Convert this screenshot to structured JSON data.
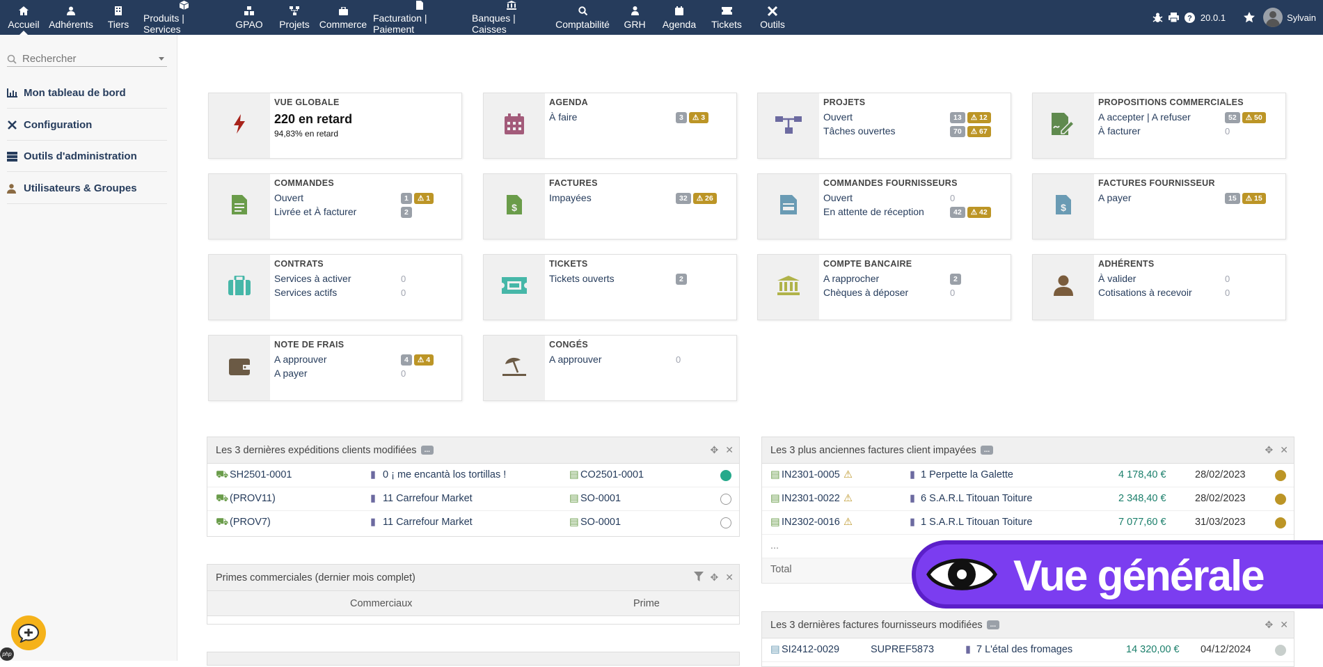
{
  "nav": {
    "items": [
      {
        "label": "Accueil",
        "icon": "home-icon"
      },
      {
        "label": "Adhérents",
        "icon": "user-icon"
      },
      {
        "label": "Tiers",
        "icon": "building-icon"
      },
      {
        "label": "Produits | Services",
        "icon": "cube-icon"
      },
      {
        "label": "GPAO",
        "icon": "cubes-icon"
      },
      {
        "label": "Projets",
        "icon": "sitemap-icon"
      },
      {
        "label": "Commerce",
        "icon": "briefcase-icon"
      },
      {
        "label": "Facturation | Paiement",
        "icon": "invoice-icon"
      },
      {
        "label": "Banques | Caisses",
        "icon": "bank-icon"
      },
      {
        "label": "Comptabilité",
        "icon": "search-dollar-icon"
      },
      {
        "label": "GRH",
        "icon": "person-icon"
      },
      {
        "label": "Agenda",
        "icon": "calendar-icon"
      },
      {
        "label": "Tickets",
        "icon": "ticket-icon"
      },
      {
        "label": "Outils",
        "icon": "tools-icon"
      }
    ],
    "version": "20.0.1",
    "user": "Sylvain"
  },
  "sidebar": {
    "search_placeholder": "Rechercher",
    "items": [
      {
        "label": "Mon tableau de bord"
      },
      {
        "label": "Configuration"
      },
      {
        "label": "Outils d'administration"
      },
      {
        "label": "Utilisateurs & Groupes"
      }
    ]
  },
  "boxes": {
    "vue_globale": {
      "title": "VUE GLOBALE",
      "main": "220 en retard",
      "sub": "94,83% en retard"
    },
    "agenda": {
      "title": "AGENDA",
      "l1": "À faire",
      "c1": "3",
      "w1": "3"
    },
    "projets": {
      "title": "PROJETS",
      "l1": "Ouvert",
      "c1": "13",
      "w1": "12",
      "l2": "Tâches ouvertes",
      "c2": "70",
      "w2": "67"
    },
    "propositions": {
      "title": "PROPOSITIONS COMMERCIALES",
      "l1": "A accepter | A refuser",
      "c1": "52",
      "w1": "50",
      "l2": "À facturer",
      "z2": "0"
    },
    "commandes": {
      "title": "COMMANDES",
      "l1": "Ouvert",
      "c1": "1",
      "w1": "1",
      "l2": "Livrée et À facturer",
      "c2": "2"
    },
    "factures": {
      "title": "FACTURES",
      "l1": "Impayées",
      "c1": "32",
      "w1": "26"
    },
    "commandes_fourn": {
      "title": "COMMANDES FOURNISSEURS",
      "l1": "Ouvert",
      "z1": "0",
      "l2": "En attente de réception",
      "c2": "42",
      "w2": "42"
    },
    "factures_fourn": {
      "title": "FACTURES FOURNISSEUR",
      "l1": "A payer",
      "c1": "15",
      "w1": "15"
    },
    "contrats": {
      "title": "CONTRATS",
      "l1": "Services à activer",
      "z1": "0",
      "l2": "Services actifs",
      "z2": "0"
    },
    "tickets": {
      "title": "TICKETS",
      "l1": "Tickets ouverts",
      "c1": "2"
    },
    "compte_bancaire": {
      "title": "COMPTE BANCAIRE",
      "l1": "A rapprocher",
      "c1": "2",
      "l2": "Chèques à déposer",
      "z2": "0"
    },
    "adherents": {
      "title": "ADHÉRENTS",
      "l1": "À valider",
      "z1": "0",
      "l2": "Cotisations à recevoir",
      "z2": "0"
    },
    "note_frais": {
      "title": "NOTE DE FRAIS",
      "l1": "A approuver",
      "c1": "4",
      "w1": "4",
      "l2": "A payer",
      "z2": "0"
    },
    "conges": {
      "title": "CONGÉS",
      "l1": "A approuver",
      "z1": "0"
    }
  },
  "panels": {
    "expeditions": {
      "title": "Les 3 dernières expéditions clients modifiées",
      "dots": "...",
      "rows": [
        {
          "ref": "SH2501-0001",
          "tiers": "0 ¡ me encantà los tortillas !",
          "cmd": "CO2501-0001",
          "status": "filled"
        },
        {
          "ref": "(PROV11)",
          "tiers": "11 Carrefour Market",
          "cmd": "SO-0001",
          "status": "empty"
        },
        {
          "ref": "(PROV7)",
          "tiers": "11 Carrefour Market",
          "cmd": "SO-0001",
          "status": "empty"
        }
      ]
    },
    "primes": {
      "title": "Primes commerciales (dernier mois complet)",
      "col1": "Commerciaux",
      "col2": "Prime"
    },
    "impayees": {
      "title": "Les 3 plus anciennes factures client impayées",
      "dots": "...",
      "rows": [
        {
          "ref": "IN2301-0005",
          "tiers": "1 Perpette la Galette",
          "amount": "4 178,40 €",
          "date": "28/02/2023"
        },
        {
          "ref": "IN2301-0022",
          "tiers": "6 S.A.R.L Titouan Toiture",
          "amount": "2 348,40 €",
          "date": "28/02/2023"
        },
        {
          "ref": "IN2302-0016",
          "tiers": "1 S.A.R.L Titouan Toiture",
          "amount": "7 077,60 €",
          "date": "31/03/2023"
        }
      ],
      "more": "...",
      "total_label": "Total"
    },
    "fourn": {
      "title": "Les 3 dernières factures fournisseurs modifiées",
      "dots": "...",
      "rows": [
        {
          "ref": "SI2412-0029",
          "supref": "SUPREF5873",
          "tiers": "7 L'étal des fromages",
          "amount": "14 320,00 €",
          "date": "04/12/2024"
        }
      ]
    }
  },
  "overlay": {
    "text": "Vue générale"
  },
  "colors": {
    "nav_bg": "#263c5c",
    "warn": "#bc9526",
    "overlay": "#7b3df0"
  }
}
